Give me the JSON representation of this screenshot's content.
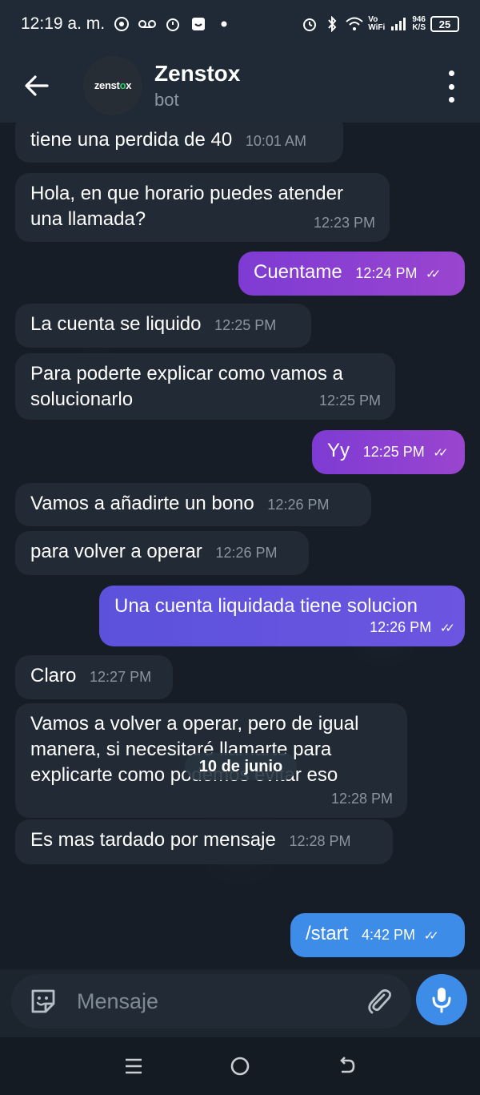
{
  "status_bar": {
    "time": "12:19 a. m.",
    "data_rate_value": "946",
    "data_rate_unit": "K/S",
    "network_label_top": "Vo",
    "network_label_bottom": "WiFi",
    "battery": "25"
  },
  "header": {
    "avatar_text_a": "zenst",
    "avatar_text_b": "o",
    "avatar_text_c": "x",
    "title": "Zenstox",
    "subtitle": "bot"
  },
  "messages": [
    {
      "text": "tiene una perdida de 40",
      "time": "10:01 AM"
    },
    {
      "text": "Hola, en que horario puedes atender una llamada?",
      "time": "12:23 PM"
    },
    {
      "text": "Cuentame",
      "time": "12:24 PM"
    },
    {
      "text": "La cuenta se liquido",
      "time": "12:25 PM"
    },
    {
      "text": "Para poderte explicar como vamos a solucionarlo",
      "time": "12:25 PM"
    },
    {
      "text": "Yy",
      "time": "12:25 PM"
    },
    {
      "text": "Vamos a añadirte un bono",
      "time": "12:26 PM"
    },
    {
      "text": "para volver a operar",
      "time": "12:26 PM"
    },
    {
      "text": "Una cuenta liquidada tiene solucion",
      "time": "12:26 PM"
    },
    {
      "text": "Claro",
      "time": "12:27 PM"
    },
    {
      "text": "Vamos a volver a operar, pero de igual manera, si necesitaré llamarte para explicarte como podemos evitar eso",
      "time": "12:28 PM"
    },
    {
      "text": "Es mas tardado por mensaje",
      "time": "12:28 PM"
    },
    {
      "text": "/start",
      "time": "4:42 PM"
    }
  ],
  "date_separator": "10 de junio",
  "input": {
    "placeholder": "Mensaje"
  },
  "colors": {
    "accent_blue": "#3c8ce8",
    "bubble_in": "#222b35",
    "bubble_purple": "#8e40d1",
    "bubble_violet": "#5f53de"
  },
  "icons": [
    "back-arrow-icon",
    "more-vert-icon",
    "sticker-icon",
    "paperclip-icon",
    "microphone-icon",
    "recents-icon",
    "home-icon",
    "back-nav-icon",
    "read-ticks-icon"
  ]
}
